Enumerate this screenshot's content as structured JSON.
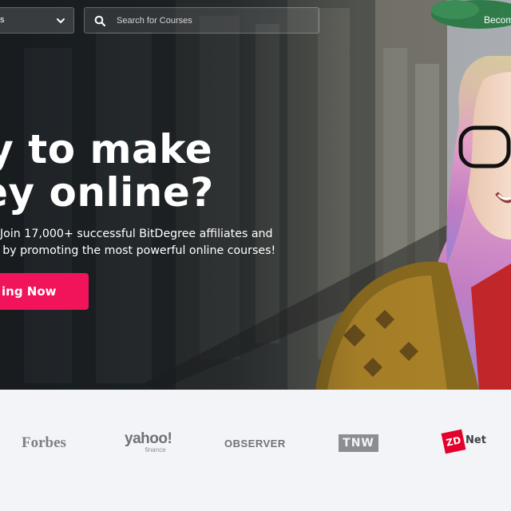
{
  "nav": {
    "category_select_label": "s",
    "search": {
      "placeholder": "Search for Courses",
      "value": ""
    },
    "become_link": "Becom"
  },
  "hero": {
    "headline_line1": "dy to make",
    "headline_line2": "ney online?",
    "subtext_line1": "Join 17,000+ successful BitDegree affiliates and",
    "subtext_line2": "e by promoting the most powerful online courses!",
    "cta_label": "ing Now"
  },
  "press": {
    "logos": [
      {
        "name": "Forbes"
      },
      {
        "name": "yahoo!",
        "sub": "finance"
      },
      {
        "name": "OBSERVER"
      },
      {
        "name": "TNW"
      },
      {
        "badge": "ZD",
        "name": "Net"
      }
    ]
  },
  "colors": {
    "accent": "#f2145b",
    "press_strip_bg": "#f3f4f7",
    "logo_gray": "#7c7f85",
    "zdnet_red": "#e3002b"
  },
  "icons": {
    "category_chevron": "chevron-down-icon",
    "search": "search-icon"
  }
}
